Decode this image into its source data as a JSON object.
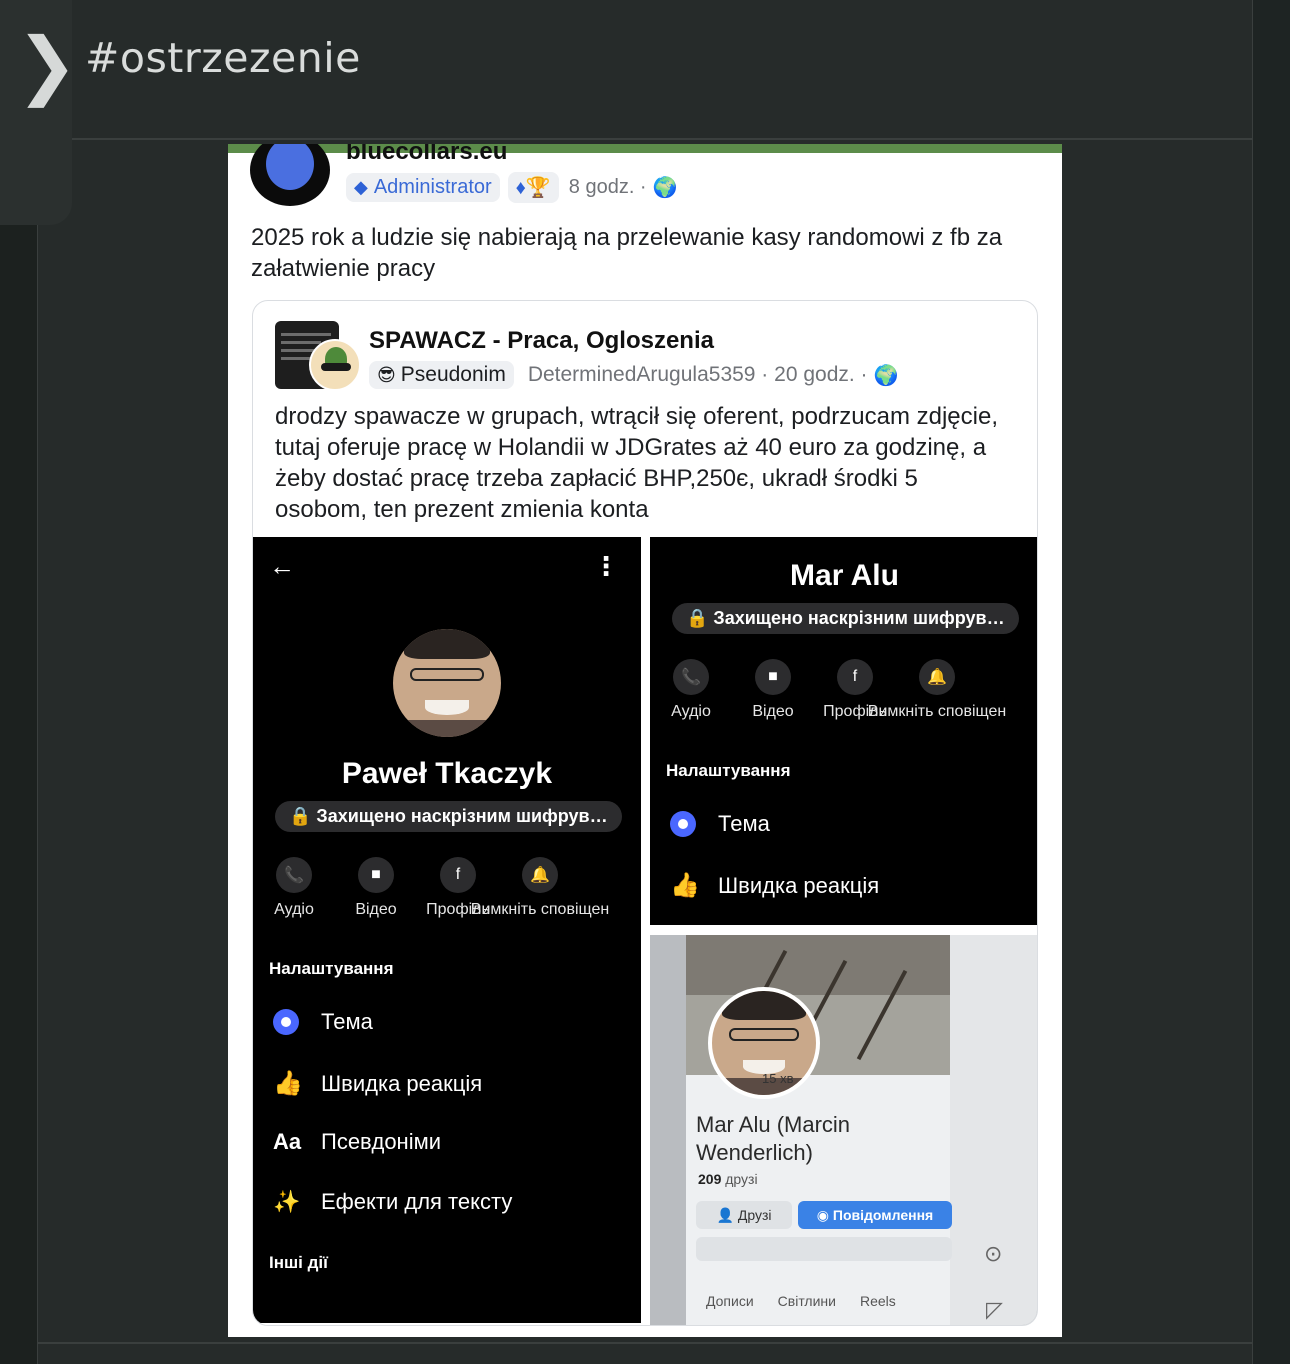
{
  "channel": {
    "hashtag": "#ostrzezenie",
    "chevron": "❯"
  },
  "post": {
    "author": "bluecollars.eu",
    "role_badge": "Administrator",
    "time": "8 godz. ·",
    "text": "2025 rok a ludzie się nabierają na przelewanie kasy randomowi z fb za załatwienie pracy"
  },
  "shared": {
    "group_name": "SPAWACZ - Praca, Ogloszenia",
    "pseudonym_badge": "Pseudonim",
    "meta": "DeterminedArugula5359 · 20 godz. ·",
    "text": "drodzy spawacze w grupach, wtrącił się oferent, podrzucam zdjęcie, tutaj oferuje pracę w Holandii w JDGrates aż 40 euro za godzinę, a żeby dostać pracę trzeba zapłacić BHP,250є, ukradł środki 5 osobom, ten prezent zmienia konta"
  },
  "screen_left": {
    "name": "Paweł Tkaczyk",
    "encryption": "🔒 Захищено наскрізним шифрув…",
    "actions": [
      "Аудіо",
      "Відео",
      "Профіль",
      "Вимкніть сповіщен"
    ],
    "settings_heading": "Налаштування",
    "rows": [
      {
        "icon": "radio",
        "label": "Тема"
      },
      {
        "icon": "👍",
        "label": "Швидка реакція"
      },
      {
        "icon": "Aa",
        "label": "Псевдоніми"
      },
      {
        "icon": "✨",
        "label": "Ефекти для тексту"
      }
    ],
    "other_heading": "Інші дії"
  },
  "screen_right_top": {
    "name": "Mar Alu",
    "encryption": "🔒 Захищено наскрізним шифрув…",
    "actions": [
      "Аудіо",
      "Відео",
      "Профіль",
      "Вимкніть сповіщен"
    ],
    "settings_heading": "Налаштування",
    "rows": [
      {
        "icon": "radio",
        "label": "Тема"
      },
      {
        "icon": "👍",
        "label": "Швидка реакція"
      }
    ]
  },
  "screen_right_bottom": {
    "time": "15 хв",
    "name": "Mar Alu (Marcin Wenderlich)",
    "friends_count": "209",
    "friends_label": "друзі",
    "btn_friends": "Друзі",
    "btn_message": "Повідомлення",
    "tabs": [
      "Дописи",
      "Світлини",
      "Reels"
    ]
  }
}
